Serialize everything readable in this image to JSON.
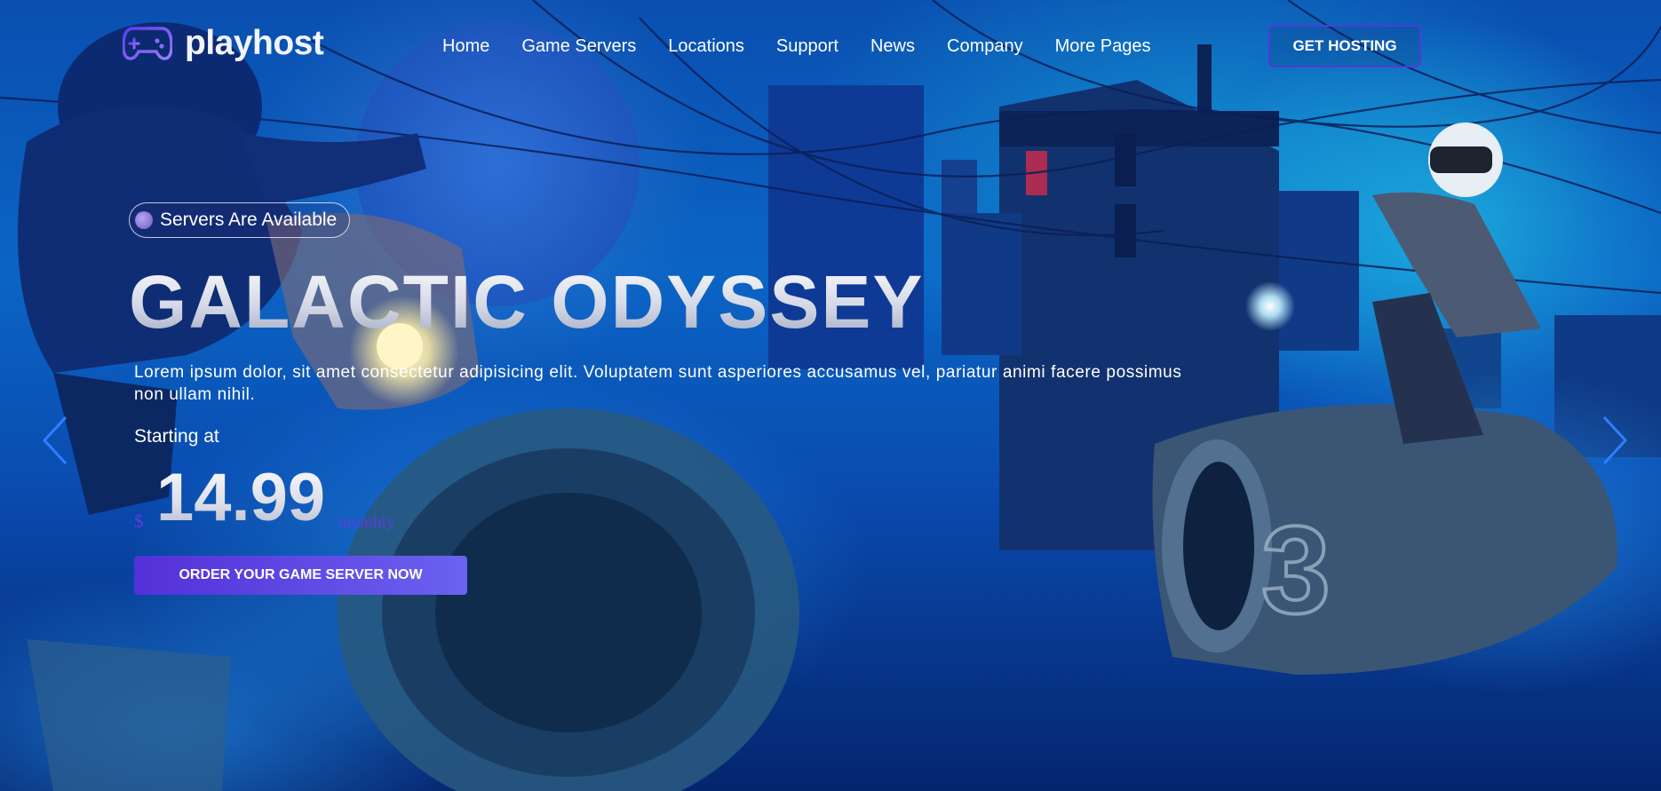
{
  "brand": {
    "name": "playhost",
    "logo_icon": "gamepad-icon",
    "accent": "#5a3de0"
  },
  "nav": {
    "items": [
      {
        "label": "Home"
      },
      {
        "label": "Game Servers"
      },
      {
        "label": "Locations"
      },
      {
        "label": "Support"
      },
      {
        "label": "News"
      },
      {
        "label": "Company"
      },
      {
        "label": "More Pages"
      }
    ],
    "cta": "GET HOSTING"
  },
  "hero": {
    "badge": "Servers Are Available",
    "title": "GALACTIC ODYSSEY",
    "description": "Lorem ipsum dolor, sit amet consectetur adipisicing elit. Voluptatem sunt asperiores accusamus vel, pariatur animi facere possimus non ullam nihil.",
    "starting_label": "Starting at",
    "currency": "$",
    "price": "14.99",
    "period": "monthly",
    "order_button": "ORDER YOUR GAME SERVER NOW"
  },
  "carousel": {
    "prev_icon": "chevron-left-icon",
    "next_icon": "chevron-right-icon"
  }
}
